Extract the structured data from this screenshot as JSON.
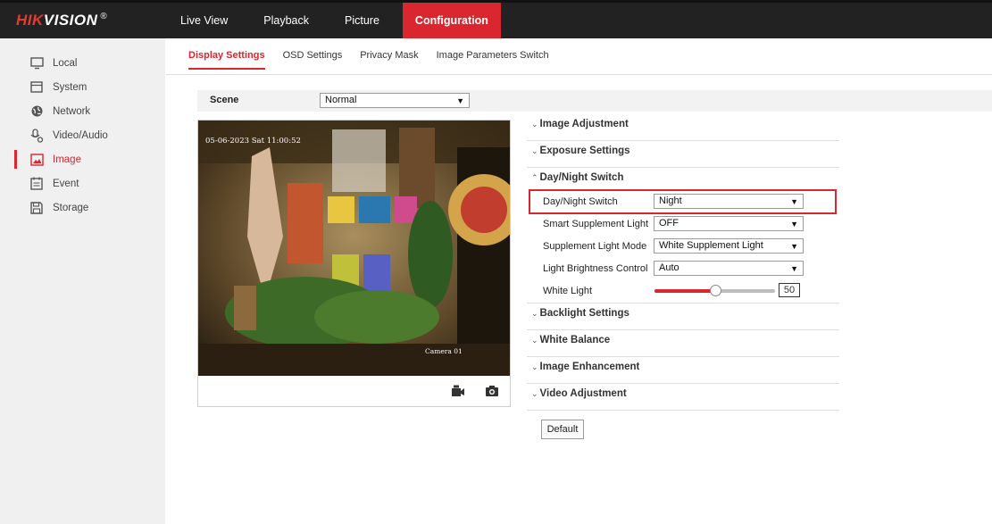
{
  "brand": {
    "logo_red": "HIK",
    "logo_white": "VISION",
    "logo_mark": "®"
  },
  "nav": [
    {
      "label": "Live View",
      "active": false
    },
    {
      "label": "Playback",
      "active": false
    },
    {
      "label": "Picture",
      "active": false
    },
    {
      "label": "Configuration",
      "active": true
    }
  ],
  "sidebar": {
    "items": [
      {
        "label": "Local",
        "icon": "monitor-icon"
      },
      {
        "label": "System",
        "icon": "system-icon"
      },
      {
        "label": "Network",
        "icon": "network-icon"
      },
      {
        "label": "Video/Audio",
        "icon": "video-audio-icon"
      },
      {
        "label": "Image",
        "icon": "image-icon",
        "active": true
      },
      {
        "label": "Event",
        "icon": "event-icon"
      },
      {
        "label": "Storage",
        "icon": "storage-icon"
      }
    ]
  },
  "subtabs": [
    {
      "label": "Display Settings",
      "active": true
    },
    {
      "label": "OSD Settings"
    },
    {
      "label": "Privacy Mask"
    },
    {
      "label": "Image Parameters Switch"
    }
  ],
  "scene": {
    "label": "Scene",
    "value": "Normal"
  },
  "video": {
    "osd_timestamp": "05-06-2023 Sat 11:00:52",
    "osd_camera": "Camera 01",
    "record_icon": "record-icon",
    "snapshot_icon": "camera-icon"
  },
  "sections": {
    "image_adjustment": "Image Adjustment",
    "exposure_settings": "Exposure Settings",
    "day_night_switch": "Day/Night Switch",
    "backlight_settings": "Backlight Settings",
    "white_balance": "White Balance",
    "image_enhancement": "Image Enhancement",
    "video_adjustment": "Video Adjustment"
  },
  "day_night": {
    "switch_label": "Day/Night Switch",
    "switch_value": "Night",
    "smart_label": "Smart Supplement Light",
    "smart_value": "OFF",
    "mode_label": "Supplement Light Mode",
    "mode_value": "White Supplement Light",
    "brightness_label": "Light Brightness Control",
    "brightness_value": "Auto",
    "white_light_label": "White Light",
    "white_light_value": "50",
    "white_light_max": 100
  },
  "buttons": {
    "default": "Default"
  },
  "colors": {
    "accent": "#d9262f",
    "topbar": "#222222",
    "sidebar": "#f0f0f0"
  }
}
